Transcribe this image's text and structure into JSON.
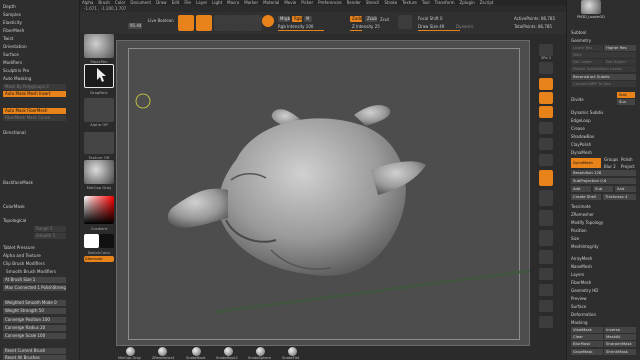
{
  "menu": [
    "Alpha",
    "Brush",
    "Color",
    "Document",
    "Draw",
    "Edit",
    "File",
    "Layer",
    "Light",
    "Macro",
    "Marker",
    "Material",
    "Movie",
    "Picker",
    "Preferences",
    "Render",
    "Stencil",
    "Stroke",
    "Texture",
    "Tool",
    "Transform",
    "Zplugin",
    "Zscript"
  ],
  "coords": "-1.671 , -1.200,1.707",
  "toolbar": {
    "zoom_value": "95.44",
    "live_boolean": "Live Boolean",
    "mrgb": "Mrgb",
    "rgb": "Rgb",
    "m": "M",
    "zadd": "Zadd",
    "zsub": "Zsub",
    "zcut": "Zcut",
    "rgb_intensity": "Rgb Intensity 100",
    "z_intensity": "Z Intensity 25",
    "focal_shift": "Focal Shift 0",
    "draw_size": "Draw Size 49",
    "dynamic": "Dynamic",
    "active_points": "ActivePoints: 86,785",
    "total_points": "TotalPoints: 86,785"
  },
  "left_panel": {
    "menu_items": [
      "Depth",
      "Samples",
      "Elasticity",
      "FiberMesh",
      "Twist",
      "Orientation",
      "Surface",
      "Modifiers",
      "Sculptris Pro",
      "Auto Masking"
    ],
    "mask_by_polygroups": "Mask By Polygroups 0",
    "auto_mask_mesh_insert": "Auto Mask Mesh Insert",
    "auto_mask_fibermesh": "Auto Mask FiberMesh",
    "fibermesh_mask_curve": "FiberMesh Mask Curve",
    "directional": "Directional",
    "backface_mask": "BackfaceMask",
    "color_mask": "ColorMask",
    "topological": "Topological",
    "range": "Range 5",
    "smooth": "Smooth 5",
    "tablet_pressure": "Tablet Pressure",
    "alpha_and_texture": "Alpha and Texture",
    "clip_brush_modifiers": "Clip Brush Modifiers",
    "smooth_brush_modifiers": "Smooth Brush Modifiers",
    "at_brush_size": "At Brush Size 1",
    "max_connected": "Max Connected 1  PolishStrength",
    "weighted_smooth": "Weighted Smooth Mode 0",
    "weight_strength": "Weight Strength 50",
    "converge_position": "Converge Position 100",
    "converge_radius": "Converge Radius 20",
    "converge_scale": "Converge Scale 100",
    "reset_current_brush": "Reset Current Brush",
    "reset_all_brushes": "Reset All Brushes"
  },
  "tool_column": {
    "brush_label": "MovePen",
    "stroke_label": "DragRect",
    "alpha_label": "Alpha Off",
    "texture_label": "Texture Off",
    "material_label": "MatCap Gray",
    "gradient_label": "Gradient",
    "switch_color_label": "SwitchColor",
    "alternate_label": "Alternate"
  },
  "icon_column": [
    "SPix 3",
    "Scroll",
    "Zoom",
    "Actual",
    "AAHalf",
    "Persp",
    "Floor",
    "Local",
    "Frame",
    "Move",
    "Scale",
    "Rotate",
    "Line Fill",
    "Transp",
    "Ghost",
    "Solo",
    "Xpose"
  ],
  "right_panel": {
    "subtool": "Subtool",
    "geometry": "Geometry",
    "lower_res": "Lower Res",
    "higher_res": "Higher Res",
    "sdiv": "SDiv",
    "del_lower": "Del Lower",
    "del_higher": "Del Higher",
    "freeze_subdivision": "Freeze SubDivision Levels",
    "reconstruct_subdiv": "Reconstruct Subdiv",
    "convert_bpr": "Convert BPR To Geo",
    "divide": "Divide",
    "smt": "Smt",
    "suv": "Suv",
    "rsmt": "ReUV",
    "dynamic_subdiv": "Dynamic Subdiv",
    "edge_loop": "EdgeLoop",
    "crease": "Crease",
    "shadowbox": "ShadowBox",
    "clay_polish": "ClayPolish",
    "dynamesh": "DynaMesh",
    "dynamesh_btn": "DynaMesh",
    "groups": "Groups",
    "polish": "Polish",
    "blur": "Blur 2",
    "project": "Project",
    "resolution": "Resolution 128",
    "subprojection": "SubProjection 0.6",
    "add": "Add",
    "sub": "Sub",
    "and": "And",
    "create_shell": "Create Shell",
    "thickness": "Thickness 4",
    "tessimate": "Tessimate",
    "zremesher": "ZRemesher",
    "modify_topology": "Modify Topology",
    "position": "Position",
    "size": "Size",
    "mesh_integrity": "MeshIntegrity",
    "array_mesh": "ArrayMesh",
    "nano_mesh": "NanoMesh",
    "layers": "Layers",
    "fibermesh": "FiberMesh",
    "geometry_hd": "Geometry HD",
    "preview": "Preview",
    "surface": "Surface",
    "deformation": "Deformation",
    "masking": "Masking",
    "view_mask": "ViewMask",
    "inverse": "Inverse",
    "clear": "Clear",
    "mask_all": "MaskAll",
    "blur_mask": "BlurMask",
    "sharpen_mask": "SharpenMask",
    "grow_mask": "GrowMask",
    "shrink_mask": "ShrinkMask",
    "thumbnail_label": "PM3D_Loader3D"
  },
  "shelf": [
    "MatCap Gray",
    "ZRemesher4",
    "SnakeHook",
    "SnakeHook2",
    "SnakeSphere",
    "SnakeFlat"
  ],
  "colors": {
    "accent": "#e8821a",
    "canvas": "#4d4d4d",
    "panel": "#2e2e2e"
  }
}
